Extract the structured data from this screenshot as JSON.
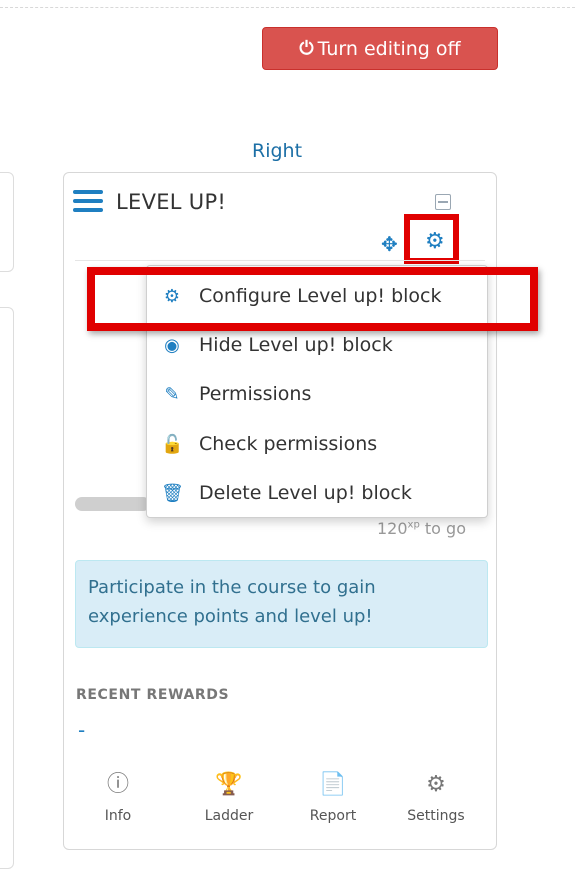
{
  "toolbar": {
    "edit_button_label": "Turn editing off",
    "edit_button_icon": "power-icon"
  },
  "region": {
    "label": "Right"
  },
  "block": {
    "title": "LEVEL UP!",
    "menu": [
      {
        "label": "Configure Level up! block",
        "icon": "gear-icon"
      },
      {
        "label": "Hide Level up! block",
        "icon": "eye-icon"
      },
      {
        "label": "Permissions",
        "icon": "edit-icon"
      },
      {
        "label": "Check permissions",
        "icon": "unlock-icon"
      },
      {
        "label": "Delete Level up! block",
        "icon": "trash-icon"
      }
    ],
    "progress_text_num": "120",
    "progress_text_sup": "xp",
    "progress_text_suffix": " to go",
    "info_message": "Participate in the course to gain experience points and level up!",
    "recent_rewards_title": "RECENT REWARDS",
    "recent_rewards_value": "-",
    "nav": [
      {
        "label": "Info",
        "icon": "info-icon"
      },
      {
        "label": "Ladder",
        "icon": "trophy-icon"
      },
      {
        "label": "Report",
        "icon": "report-icon"
      },
      {
        "label": "Settings",
        "icon": "gear-icon"
      }
    ]
  },
  "colors": {
    "accent": "#1f7fc1",
    "danger": "#d9534f",
    "highlight": "#e00000",
    "info_bg": "#d9edf7"
  }
}
